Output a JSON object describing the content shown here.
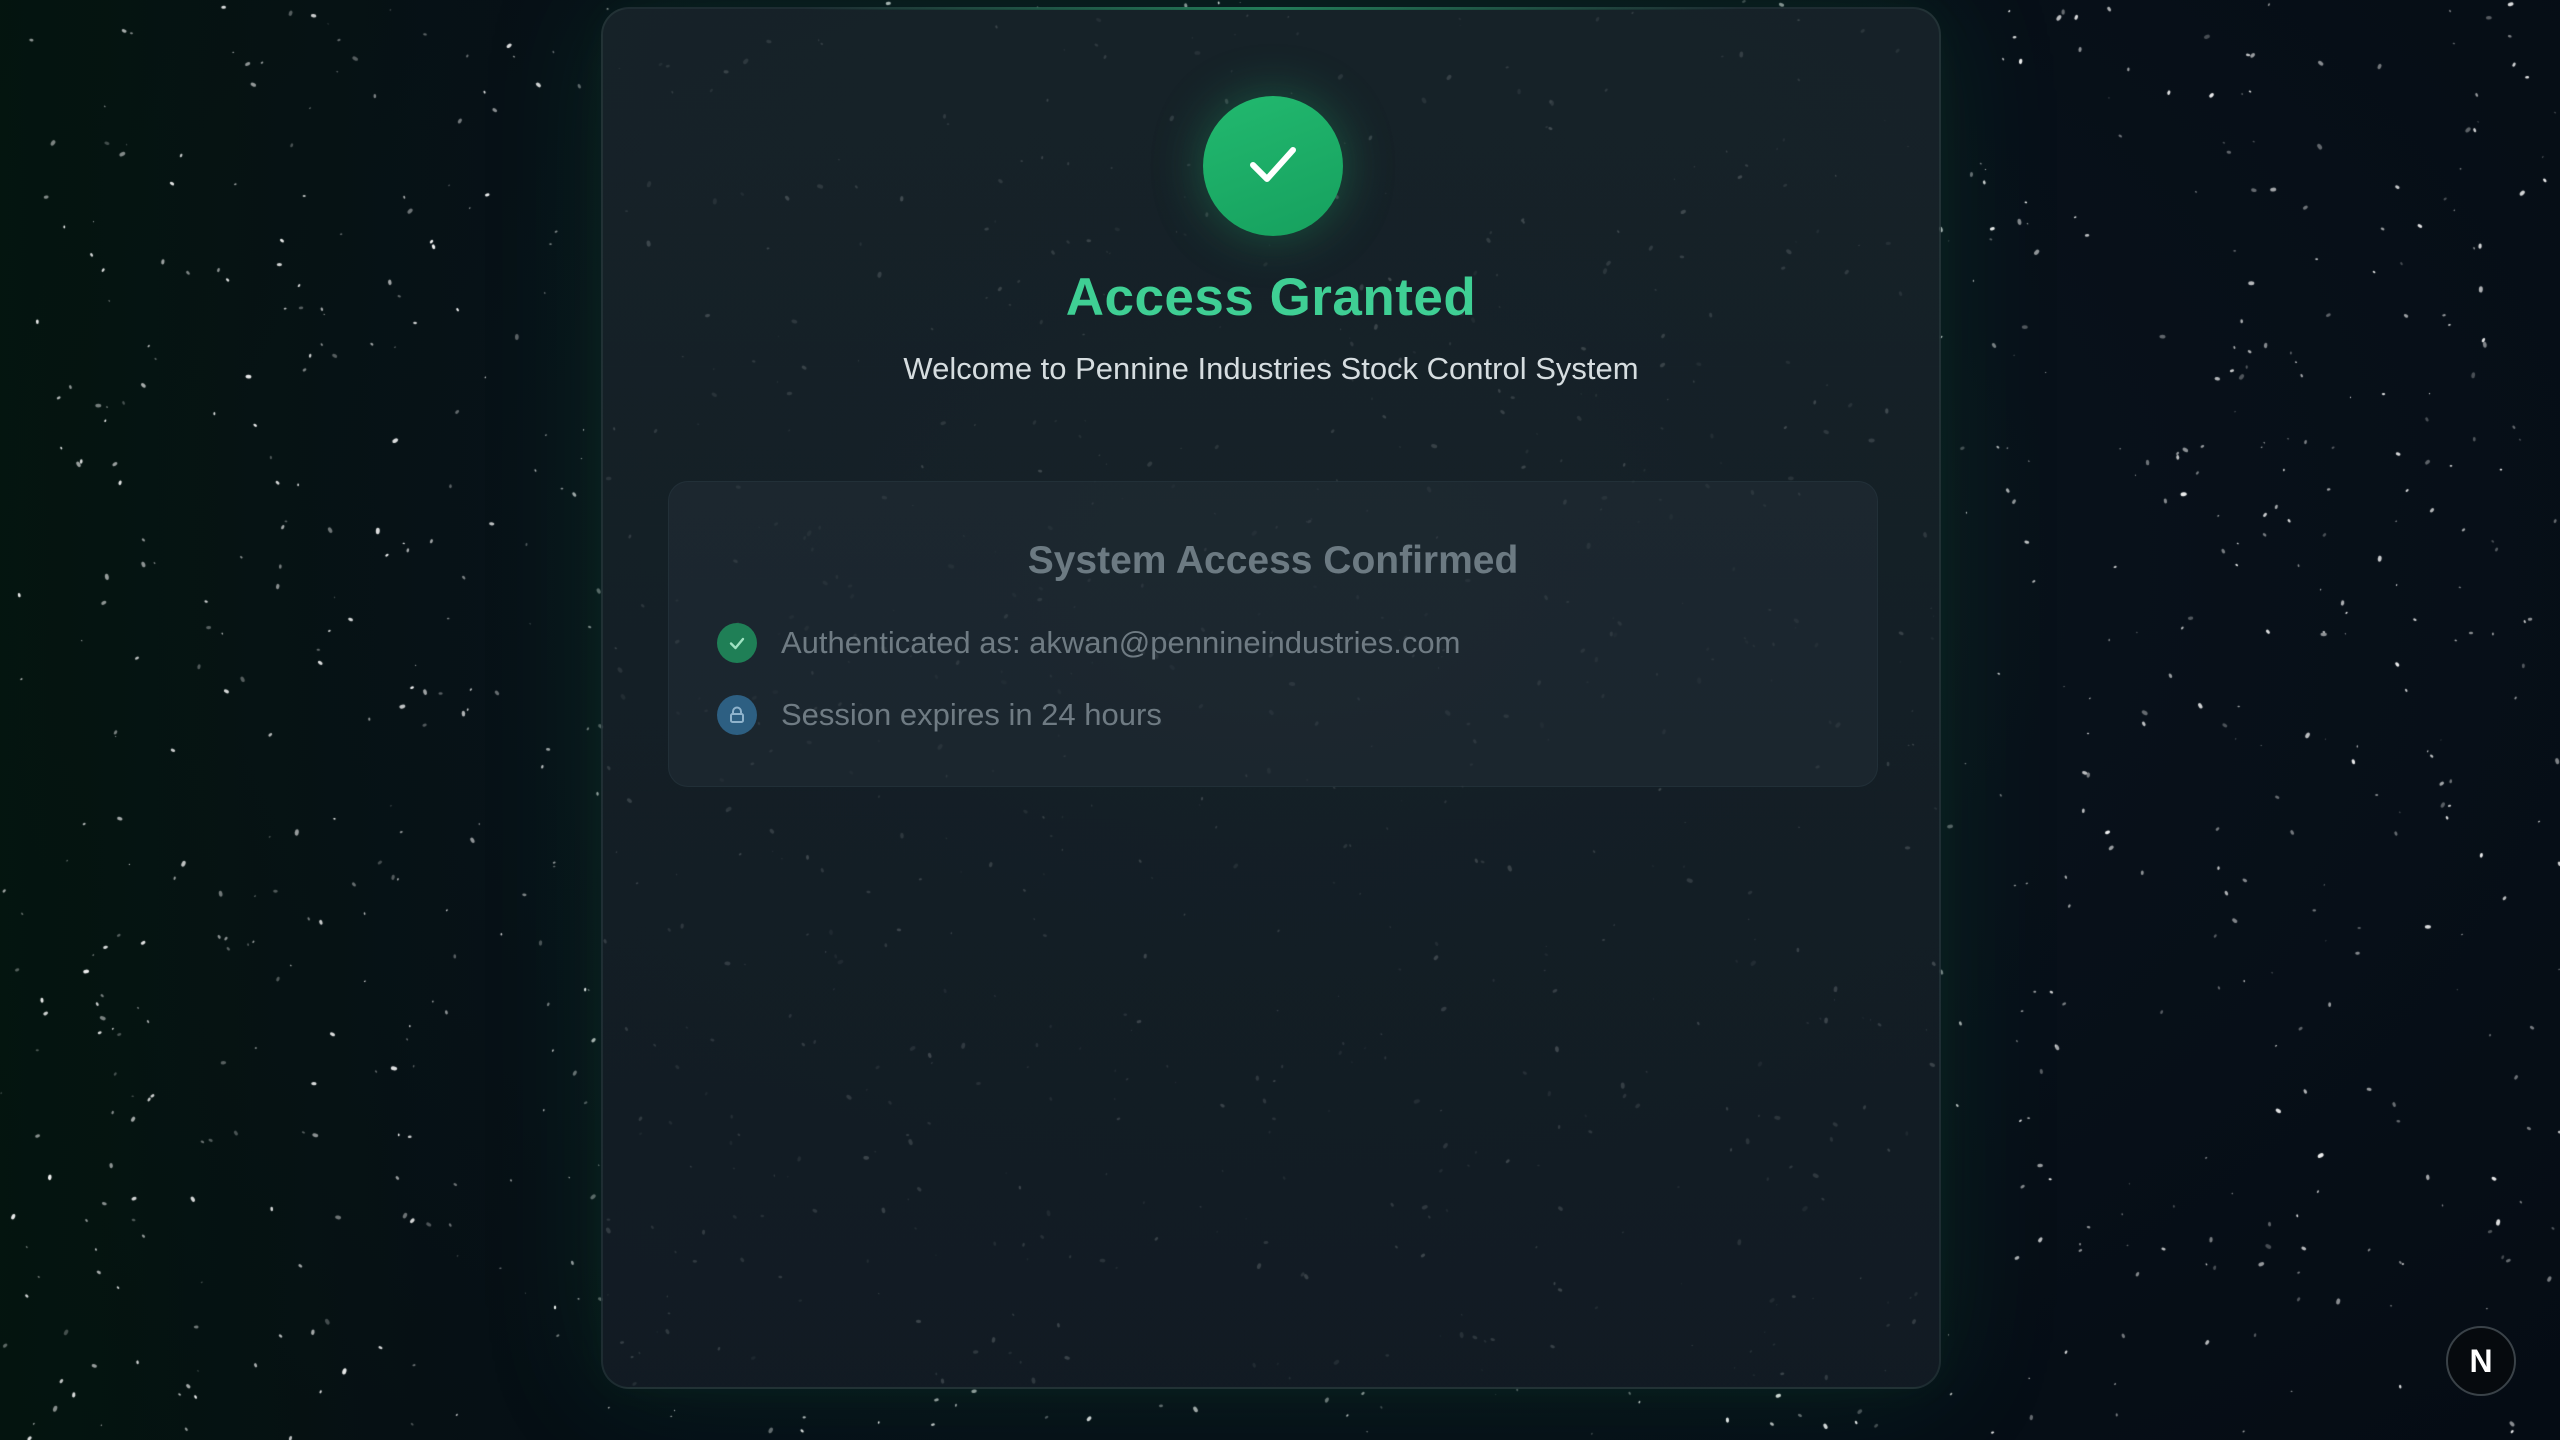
{
  "status": {
    "title": "Access Granted",
    "subtitle": "Welcome to Pennine Industries Stock Control System",
    "badge_icon": "checkmark-icon"
  },
  "confirmation_panel": {
    "title": "System Access Confirmed",
    "items": [
      {
        "icon": "check-circle-icon",
        "text": "Authenticated as: akwan@pennineindustries.com"
      },
      {
        "icon": "lock-icon",
        "text": "Session expires in 24 hours"
      }
    ]
  },
  "corner_button": {
    "label": "N"
  },
  "colors": {
    "accent_green": "#3fcf94",
    "badge_green": "#22b96f",
    "lock_blue": "#2d5f82",
    "background": "#08111a"
  }
}
